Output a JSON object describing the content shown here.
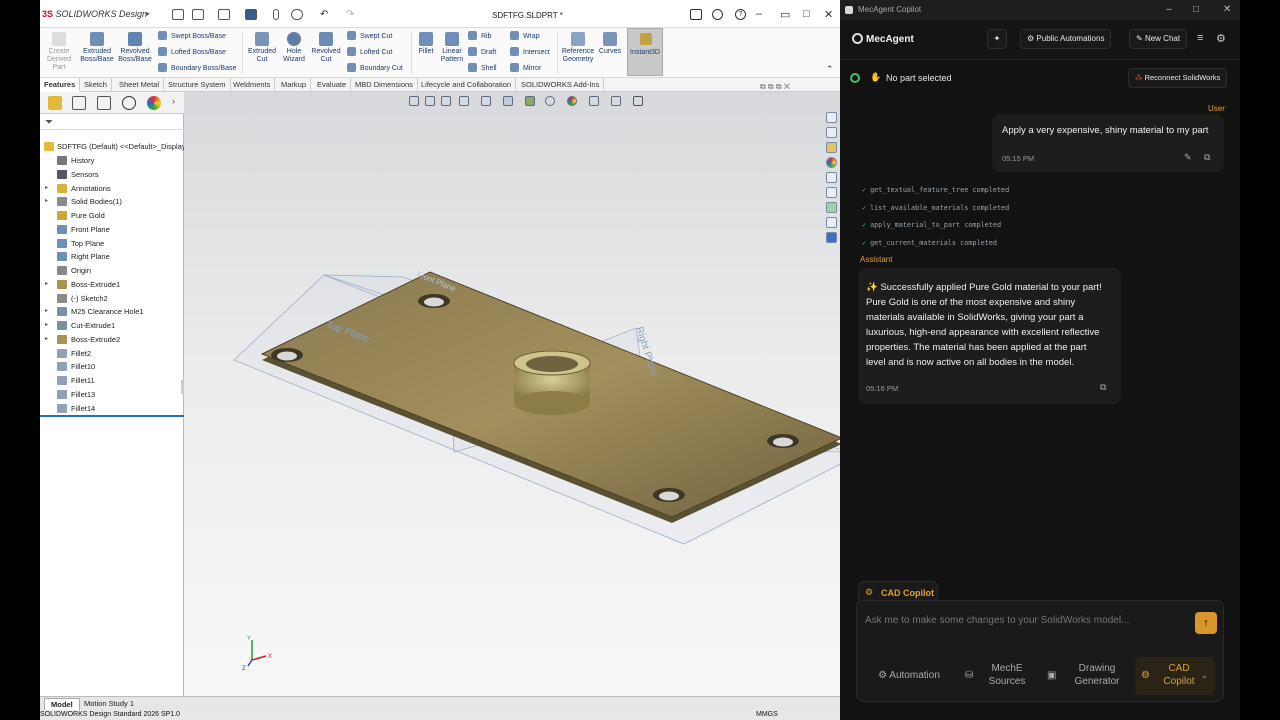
{
  "solidworks": {
    "app_title": "SOLIDWORKS Design",
    "logo_prefix": "3S",
    "file_name": "SDFTFG.SLDPRT *",
    "ribbon": {
      "create_derived": "Create\nDerived\nPart",
      "extruded_boss": "Extruded\nBoss/Base",
      "revolved_boss": "Revolved\nBoss/Base",
      "swept_boss": "Swept Boss/Base",
      "lofted_boss": "Lofted Boss/Base",
      "boundary_boss": "Boundary Boss/Base",
      "extruded_cut": "Extruded\nCut",
      "hole_wizard": "Hole\nWizard",
      "revolved_cut": "Revolved\nCut",
      "swept_cut": "Swept Cut",
      "lofted_cut": "Lofted Cut",
      "boundary_cut": "Boundary Cut",
      "fillet": "Fillet",
      "linear_pattern": "Linear\nPattern",
      "rib": "Rib",
      "draft": "Draft",
      "shell": "Shell",
      "wrap": "Wrap",
      "intersect": "Intersect",
      "mirror": "Mirror",
      "reference_geometry": "Reference\nGeometry",
      "curves": "Curves",
      "instant3d": "Instant3D"
    },
    "tabs": [
      "Features",
      "Sketch",
      "Sheet Metal",
      "Structure System",
      "Weldments",
      "Markup",
      "Evaluate",
      "MBD Dimensions",
      "Lifecycle and Collaboration",
      "SOLIDWORKS Add-Ins"
    ],
    "tree": {
      "root": "SDFTFG (Default) <<Default>_Display",
      "items": [
        "History",
        "Sensors",
        "Annotations",
        "Solid Bodies(1)",
        "Pure Gold",
        "Front Plane",
        "Top Plane",
        "Right Plane",
        "Origin",
        "Boss-Extrude1",
        "(-) Sketch2",
        "M25 Clearance Hole1",
        "Cut-Extrude1",
        "Boss-Extrude2",
        "Fillet2",
        "Fillet10",
        "Fillet11",
        "Fillet13",
        "Fillet14"
      ]
    },
    "viewport": {
      "plane_labels": [
        "Top Plane",
        "Front Plane",
        "Right Plane"
      ],
      "triad_labels": [
        "Y",
        "X",
        "Z"
      ]
    },
    "bottom_tabs": [
      "Model",
      "Motion Study 1"
    ],
    "status_left": "SOLIDWORKS Design Standard 2026 SP1.0",
    "status_units": "MMGS"
  },
  "mecagent": {
    "window_title": "MecAgent Copilot",
    "brand": "MecAgent",
    "public_automations": "Public Automations",
    "new_chat": "New Chat",
    "no_part": "No part selected",
    "reconnect": "Reconnect SolidWorks",
    "user_label": "User",
    "user_message": "Apply a very expensive, shiny material to my part",
    "user_time": "05:15 PM",
    "tools": [
      "get_textual_feature_tree completed",
      "list_available_materials completed",
      "apply_material_to_part completed",
      "get_current_materials completed"
    ],
    "assistant_label": "Assistant",
    "assistant_lines": [
      "✨ Successfully applied Pure Gold material to your part!",
      "Pure Gold is one of the most expensive and shiny",
      "materials available in SolidWorks, giving your part a",
      "luxurious, high-end appearance with excellent reflective",
      "properties. The material has been applied at the part",
      "level and is now active on all bodies in the model."
    ],
    "assistant_time": "05:16 PM",
    "cad_tab": "CAD Copilot",
    "input_placeholder": "Ask me to make some changes to your SolidWorks model...",
    "quick": {
      "automation": "Automation",
      "sources": "MechE\nSources",
      "drawing": "Drawing\nGenerator",
      "cad": "CAD\nCopilot"
    },
    "accent": "#e0a030"
  }
}
